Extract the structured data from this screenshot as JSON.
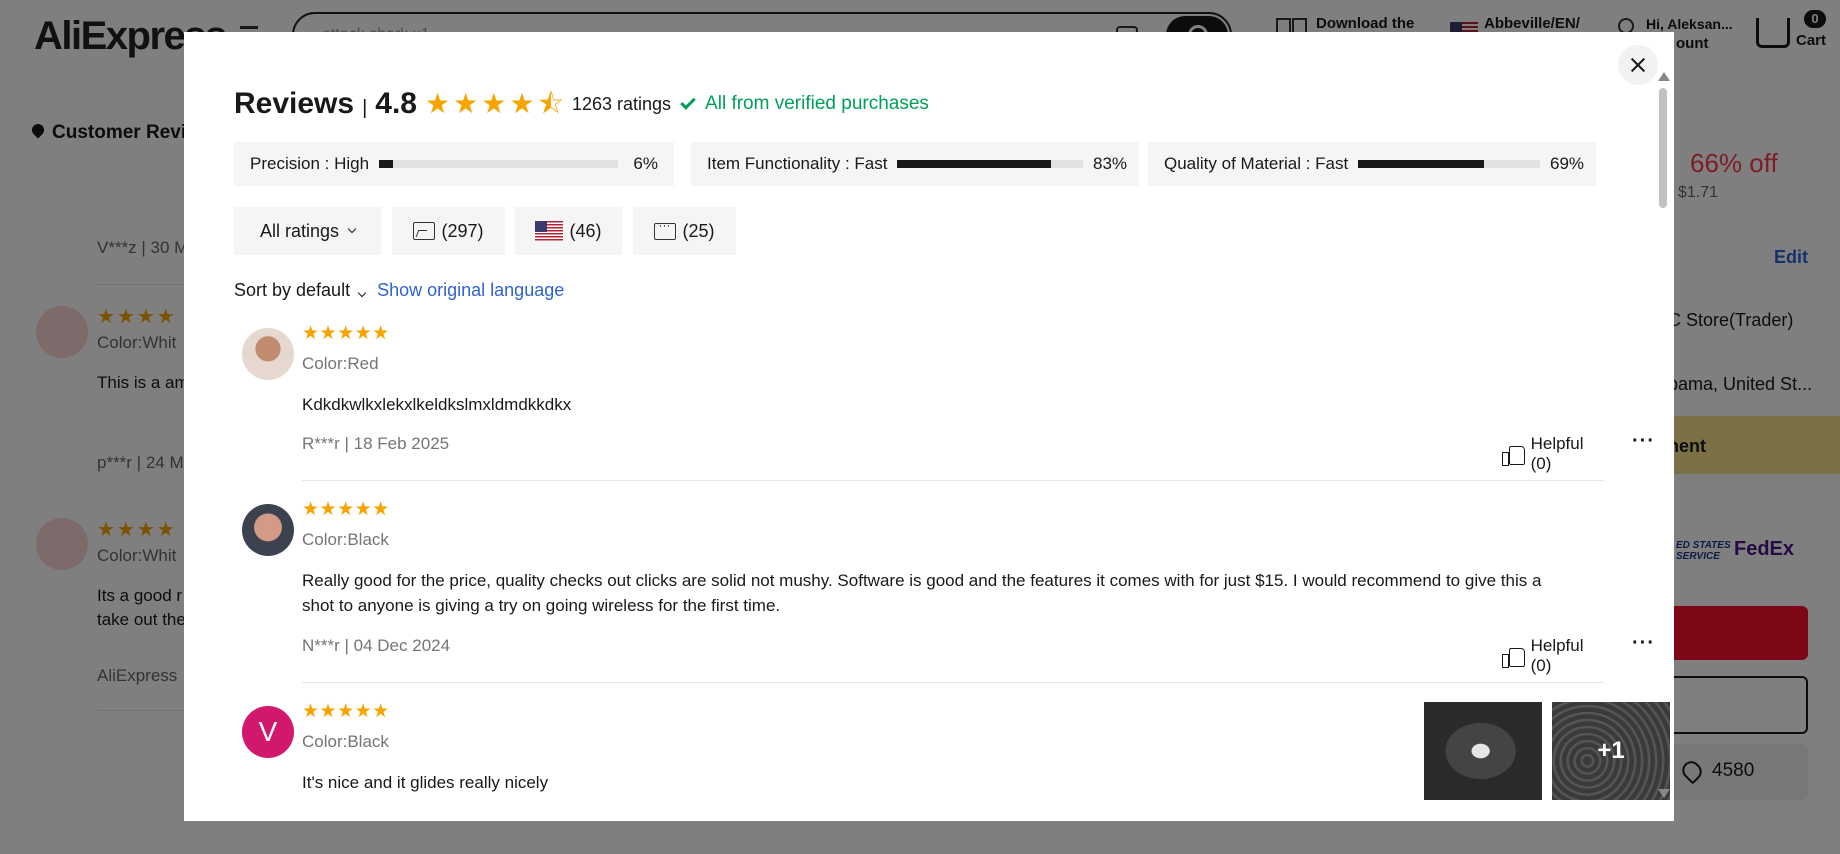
{
  "header": {
    "logo": "AliExpress",
    "search_placeholder": "attack shark x1",
    "download_label": "Download the",
    "locale_label": "Abbeville/EN/",
    "greeting": "Hi, Aleksan...",
    "account_label": "ount",
    "cart_count": "0",
    "cart_label": "Cart"
  },
  "background": {
    "section_title": "Customer Revie",
    "items": [
      {
        "meta": "V***z | 30 M",
        "color": "Color:Whit",
        "text": "This is a am"
      },
      {
        "meta": "p***r | 24 M",
        "color": "Color:Whit",
        "text": "Its a good r",
        "text2": "take out the"
      },
      {
        "meta": "AliExpress"
      }
    ],
    "right_panel": {
      "discount": "66% off",
      "price": "$1.71",
      "edit": "Edit",
      "store": "C Store(Trader)",
      "ship_to": "bama, United St...",
      "banner": "nent",
      "carrier1": "ED STATES SERVICE",
      "carrier2": "FedEx",
      "wishlist_count": "4580"
    }
  },
  "modal": {
    "title": "Reviews",
    "separator": "|",
    "rating": "4.8",
    "rating_value": 4.8,
    "ratings_count": "1263 ratings",
    "verified": "All from verified purchases",
    "metrics": [
      {
        "label": "Precision : High",
        "percent": "6%",
        "value": 0.06
      },
      {
        "label": "Item Functionality : Fast",
        "percent": "83%",
        "value": 0.83
      },
      {
        "label": "Quality of Material : Fast",
        "percent": "69%",
        "value": 0.69
      }
    ],
    "filters": {
      "all_ratings": "All ratings",
      "photos": "(297)",
      "country": "(46)",
      "comments": "(25)"
    },
    "sort_label": "Sort by default",
    "show_original": "Show original language",
    "reviews": [
      {
        "stars": "★★★★★",
        "color": "Color:Red",
        "text": "Kdkdkwlkxlekxlkeldkslmxldmdkkdkx",
        "meta": "R***r | 18 Feb 2025",
        "helpful": "Helpful (0)"
      },
      {
        "stars": "★★★★★",
        "color": "Color:Black",
        "text": "Really good for the price, quality checks out clicks are solid not mushy. Software is good and the features it comes with for just $15. I would recommend to give this a shot to anyone is giving a try on going wireless for the first time.",
        "meta": "N***r | 04 Dec 2024",
        "helpful": "Helpful (0)"
      },
      {
        "stars": "★★★★★",
        "avatar_letter": "V",
        "color": "Color:Black",
        "text": "It's nice and it glides really nicely",
        "more_images": "+1"
      }
    ],
    "more_label": "···"
  },
  "colors": {
    "star": "#f7a400",
    "verified": "#00a05a",
    "link": "#2e63d3",
    "avatar_v": "#d2186c"
  }
}
